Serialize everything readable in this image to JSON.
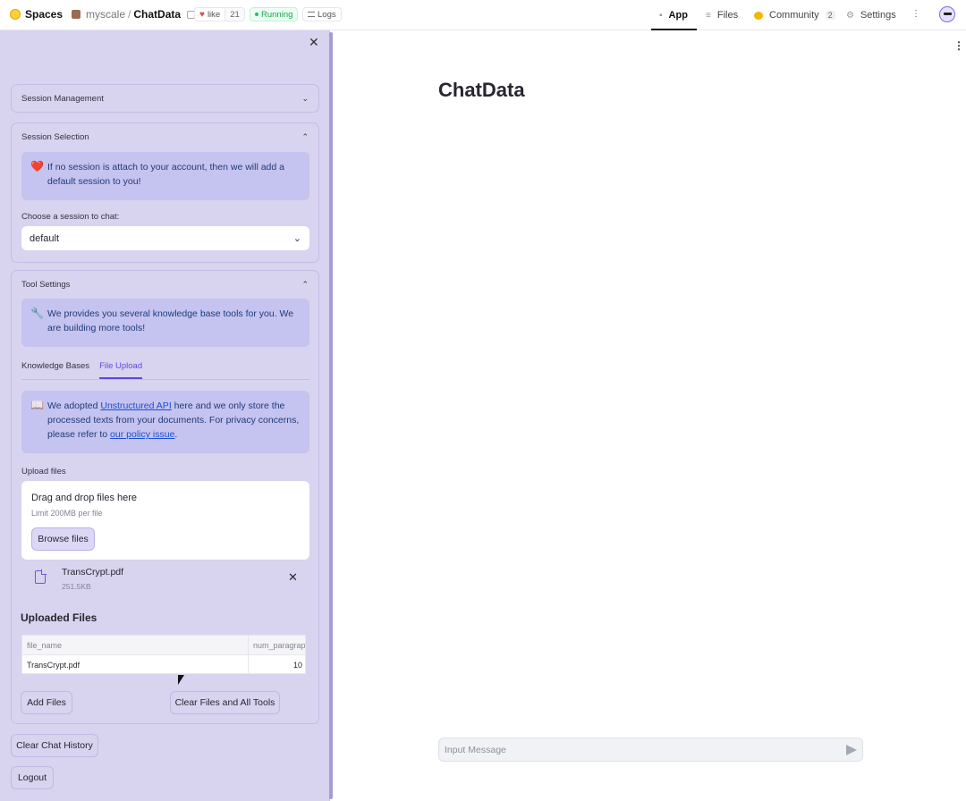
{
  "topbar": {
    "spaces_label": "Spaces",
    "owner": "myscale",
    "separator": "/",
    "repo": "ChatData",
    "like_label": "like",
    "like_count": "21",
    "status": "Running",
    "logs_label": "Logs",
    "nav": {
      "app": "App",
      "files": "Files",
      "community": "Community",
      "community_count": "2",
      "settings": "Settings"
    }
  },
  "sidebar": {
    "session_management": "Session Management",
    "session_selection": "Session Selection",
    "session_info": "If no session is attach to your account, then we will add a default session to you!",
    "session_info_emoji": "❤️",
    "choose_session_label": "Choose a session to chat:",
    "selected_session": "default",
    "tool_settings": "Tool Settings",
    "tool_info": "We provides you several knowledge base tools for you. We are building more tools!",
    "tool_info_emoji": "🔧",
    "tabs": [
      "Knowledge Bases",
      "File Upload"
    ],
    "upload_info": {
      "emoji": "📖",
      "prefix": "We adopted ",
      "link1": "Unstructured API",
      "middle": " here and we only store the processed texts from your documents. For privacy concerns, please refer to ",
      "link2": "our policy issue",
      "suffix": "."
    },
    "upload_label": "Upload files",
    "drop_title": "Drag and drop files here",
    "drop_limit": "Limit 200MB per file",
    "browse_button": "Browse files",
    "uploaded_file": {
      "name": "TransCrypt.pdf",
      "size": "251.5KB"
    },
    "uploaded_files_heading": "Uploaded Files",
    "table": {
      "columns": [
        "file_name",
        "num_paragraphs"
      ],
      "rows": [
        [
          "TransCrypt.pdf",
          "10"
        ]
      ]
    },
    "add_files_button": "Add Files",
    "clear_files_button": "Clear Files and All Tools",
    "clear_chat_button": "Clear Chat History",
    "logout_button": "Logout"
  },
  "main": {
    "title": "ChatData",
    "input_placeholder": "Input Message"
  },
  "colors": {
    "sidebar_bg": "#d8d3ef",
    "accent": "#6048e0",
    "info_bg": "#c5c3ef"
  }
}
